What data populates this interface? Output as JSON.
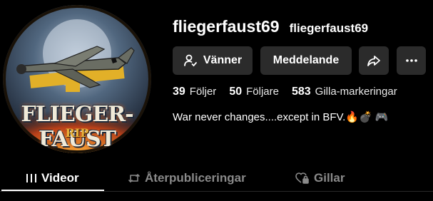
{
  "profile": {
    "username": "fliegerfaust69",
    "nickname": "fliegerfaust69",
    "avatar": {
      "title_text": "FLIEGER-FAUST",
      "subtitle_text": "RIP"
    }
  },
  "actions": {
    "friends_label": "Vänner",
    "message_label": "Meddelande"
  },
  "stats": [
    {
      "count": "39",
      "label": "Följer"
    },
    {
      "count": "50",
      "label": "Följare"
    },
    {
      "count": "583",
      "label": "Gilla-markeringar"
    }
  ],
  "bio": "War never changes....except in BFV.🔥💣 🎮",
  "tabs": [
    {
      "label": "Videor",
      "active": true,
      "icon": "grid-icon"
    },
    {
      "label": "Återpubliceringar",
      "active": false,
      "icon": "repost-icon"
    },
    {
      "label": "Gillar",
      "active": false,
      "icon": "heart-lock-icon"
    }
  ],
  "colors": {
    "background": "#000000",
    "button_bg": "#2b2b2b",
    "inactive_tab": "#8a8a8a"
  }
}
